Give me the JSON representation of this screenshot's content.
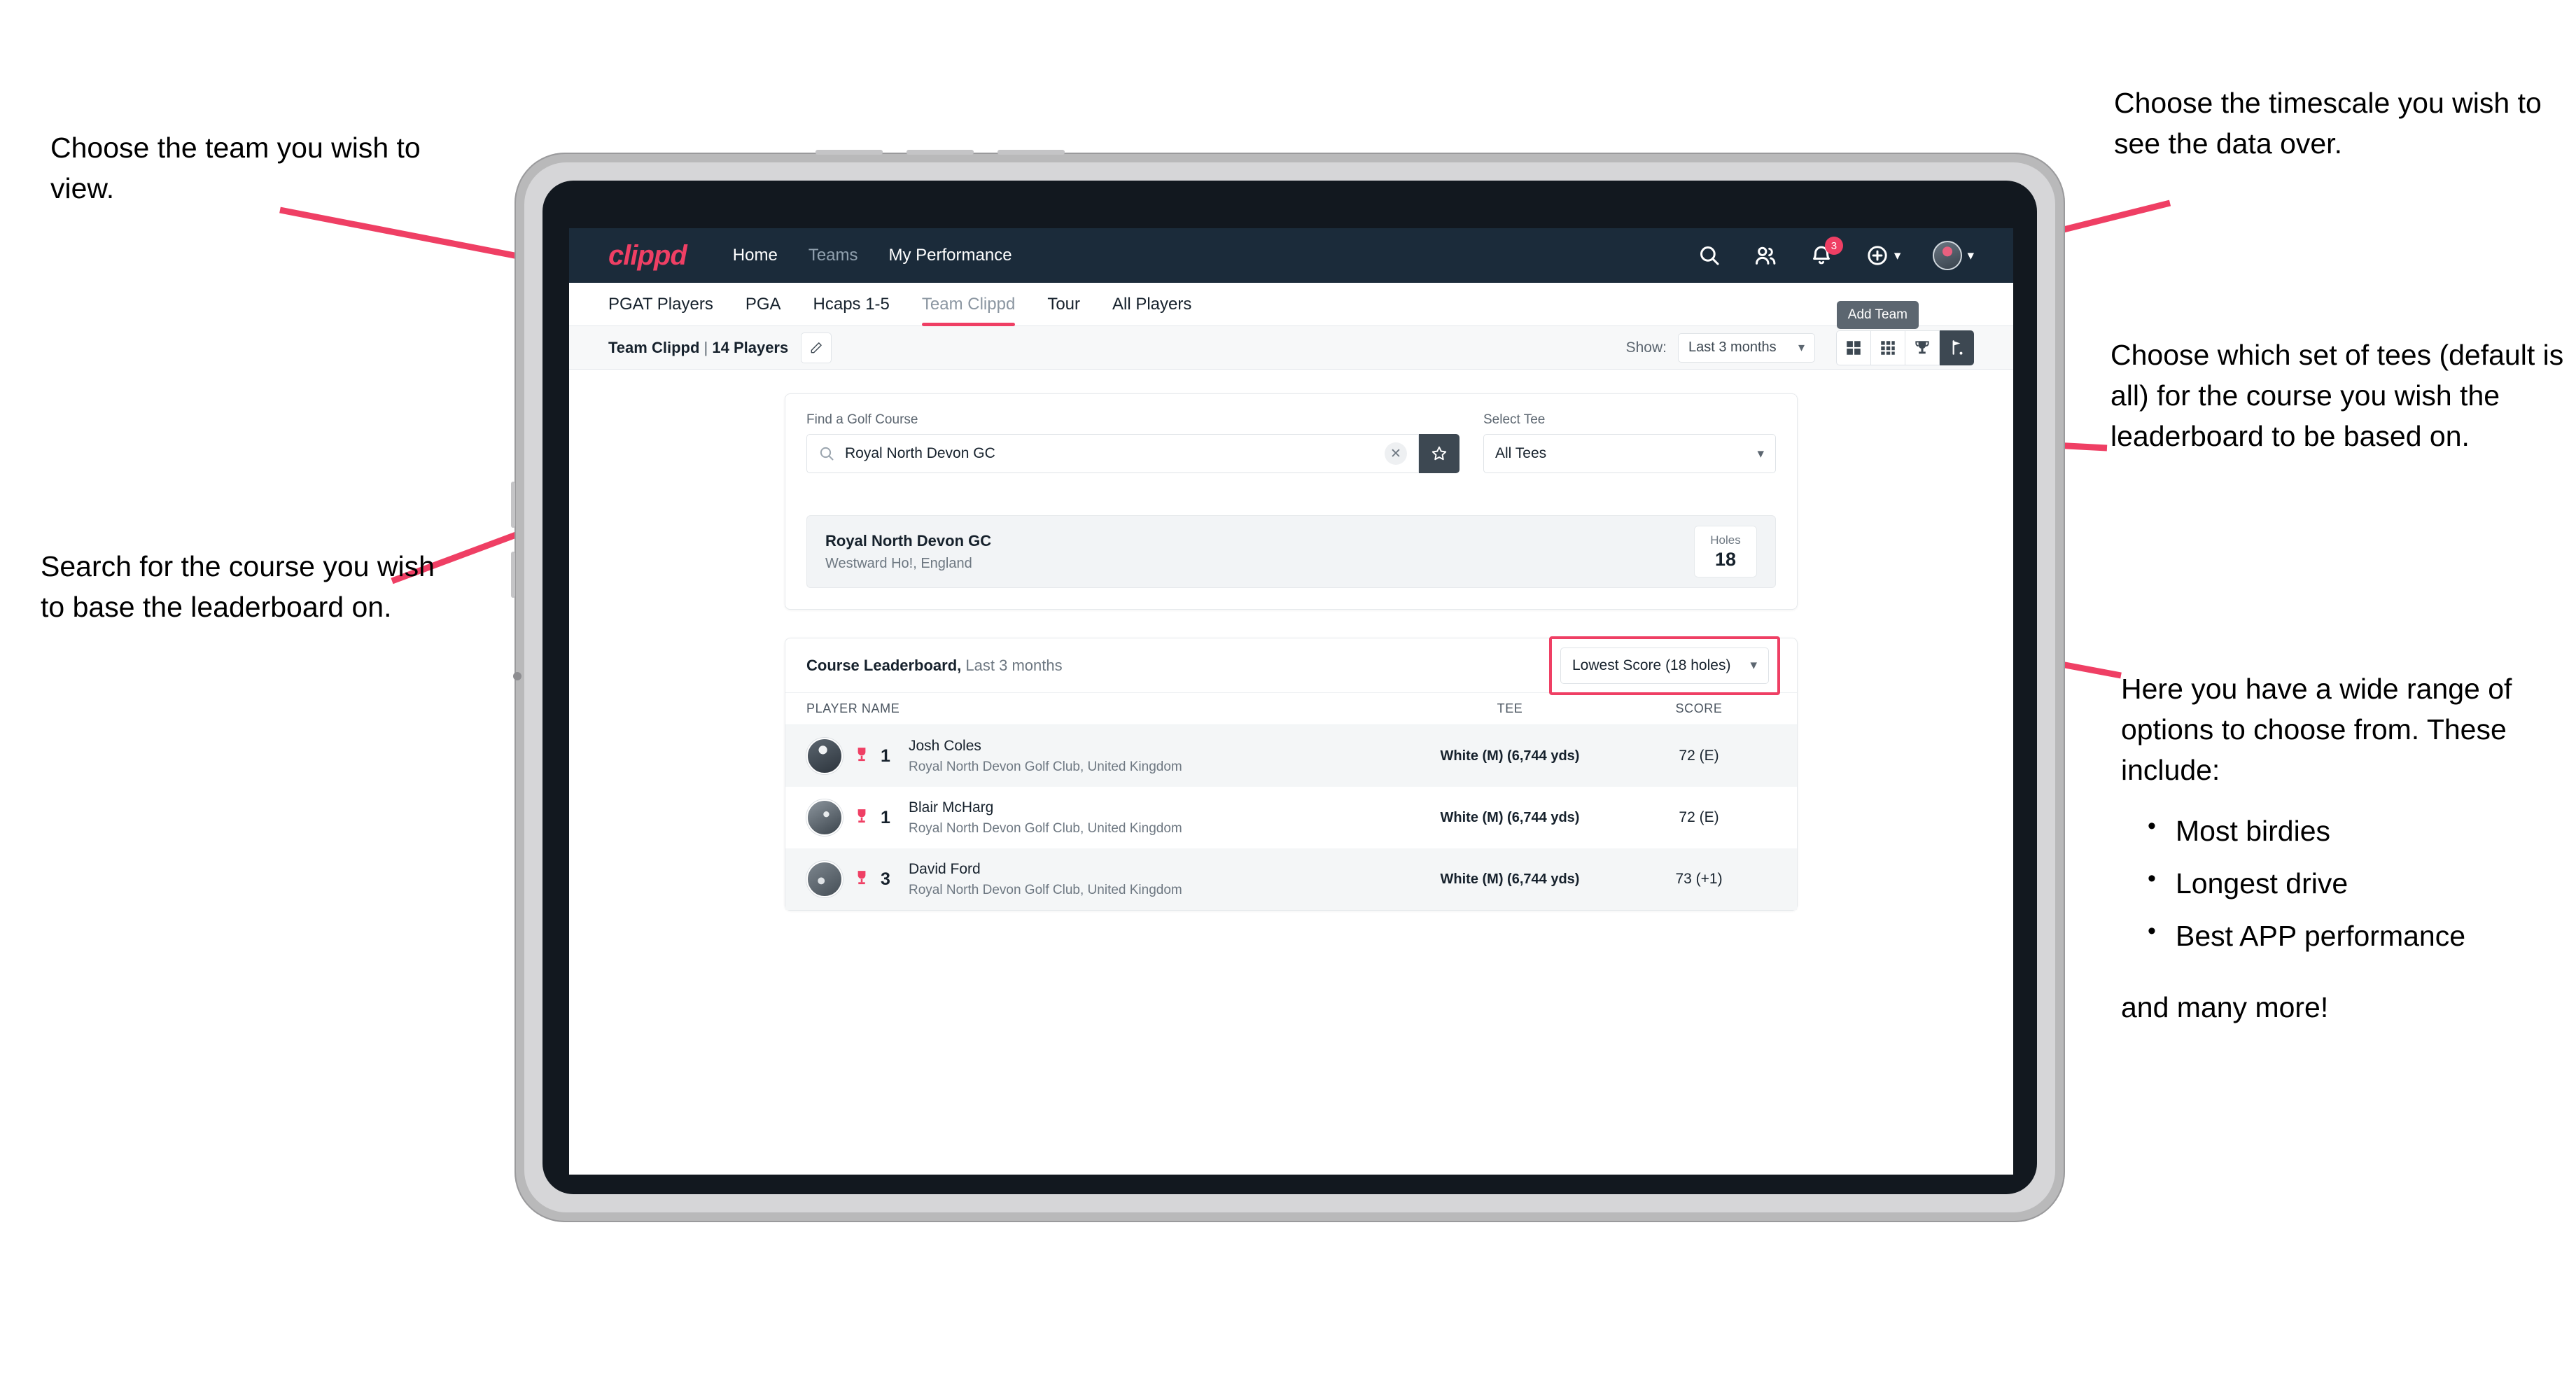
{
  "annotations": {
    "left_top": "Choose the team you wish to view.",
    "left_mid": "Search for the course you wish to base the leaderboard on.",
    "right_top": "Choose the timescale you wish to see the data over.",
    "right_mid": "Choose which set of tees (default is all) for the course you wish the leaderboard to be based on.",
    "right_bottom_intro": "Here you have a wide range of options to choose from. These include:",
    "right_bottom_items": [
      "Most birdies",
      "Longest drive",
      "Best APP performance"
    ],
    "right_bottom_tail": "and many more!"
  },
  "navbar": {
    "logo": "clippd",
    "links": [
      {
        "label": "Home",
        "active": true
      },
      {
        "label": "Teams",
        "active": false
      },
      {
        "label": "My Performance",
        "active": true
      }
    ],
    "icons": [
      "search-icon",
      "people-icon",
      "bell-icon",
      "plus-circle-icon",
      "avatar"
    ],
    "notification_count": "3"
  },
  "tabs": {
    "items": [
      "PGAT Players",
      "PGA",
      "Hcaps 1-5",
      "Team Clippd",
      "Tour",
      "All Players"
    ],
    "active": "Team Clippd",
    "tooltip": "Add Team"
  },
  "toolbar": {
    "team_name": "Team Clippd",
    "team_count": "14 Players",
    "separator": "|",
    "edit_icon": "pencil-icon",
    "show_label": "Show:",
    "timescale_value": "Last 3 months",
    "view_buttons": [
      "grid-2x2-icon",
      "grid-3x3-icon",
      "trophy-icon",
      "golf-flag-icon"
    ],
    "active_view": "golf-flag-icon"
  },
  "search": {
    "course_label": "Find a Golf Course",
    "course_value": "Royal North Devon GC",
    "clear_icon": "close-icon",
    "favourite_icon": "star-icon",
    "tee_label": "Select Tee",
    "tee_value": "All Tees"
  },
  "course_result": {
    "name": "Royal North Devon GC",
    "location": "Westward Ho!, England",
    "holes_label": "Holes",
    "holes_value": "18"
  },
  "leaderboard": {
    "title": "Course Leaderboard,",
    "subtitle": "Last 3 months",
    "sort_value": "Lowest Score (18 holes)",
    "columns": [
      "PLAYER NAME",
      "TEE",
      "SCORE"
    ],
    "rows": [
      {
        "rank": "1",
        "name": "Josh Coles",
        "club": "Royal North Devon Golf Club, United Kingdom",
        "tee": "White (M) (6,744 yds)",
        "score": "72 (E)"
      },
      {
        "rank": "1",
        "name": "Blair McHarg",
        "club": "Royal North Devon Golf Club, United Kingdom",
        "tee": "White (M) (6,744 yds)",
        "score": "72 (E)"
      },
      {
        "rank": "3",
        "name": "David Ford",
        "club": "Royal North Devon Golf Club, United Kingdom",
        "tee": "White (M) (6,744 yds)",
        "score": "73 (+1)"
      }
    ]
  },
  "colors": {
    "accent": "#ef3f64",
    "navbar": "#1b2b3a",
    "dark_button": "#3d4852"
  }
}
